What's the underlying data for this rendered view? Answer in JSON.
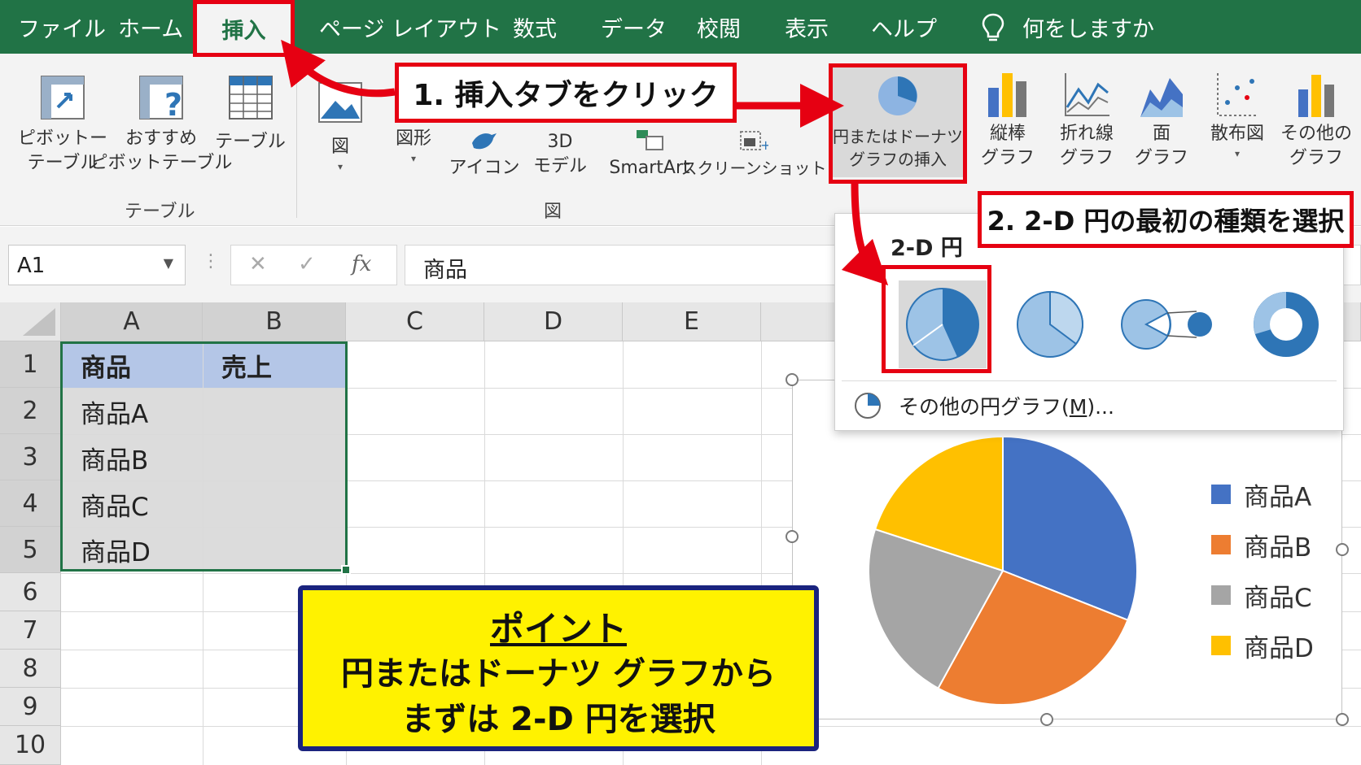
{
  "menu": {
    "tabs": [
      "ファイル",
      "ホーム",
      "挿入",
      "ページ レイアウト",
      "数式",
      "データ",
      "校閲",
      "表示",
      "ヘルプ"
    ],
    "active_tab": "挿入",
    "tell_me": "何をしますか"
  },
  "ribbon": {
    "pivot_table": [
      "ピボットー",
      "テーブル"
    ],
    "recommended_pivot": [
      "おすすめ",
      "ピボットテーブル"
    ],
    "table": "テーブル",
    "group_table": "テーブル",
    "figure": "図",
    "shapes": "図形",
    "icons": "アイコン",
    "model3d": [
      "3D",
      "モデル"
    ],
    "smartart": "SmartArt",
    "screenshot": "スクリーンショット",
    "group_figure": "図",
    "pie_donut": [
      "円またはドーナツ",
      "グラフの挿入"
    ],
    "column": [
      "縦棒",
      "グラフ"
    ],
    "line": [
      "折れ線",
      "グラフ"
    ],
    "area": [
      "面",
      "グラフ"
    ],
    "scatter": "散布図",
    "other": [
      "その他の",
      "グラフ"
    ]
  },
  "formula_bar": {
    "name_box": "A1",
    "cancel": "✕",
    "enter": "✓",
    "fx": "fx",
    "content": "商品"
  },
  "sheet": {
    "columns": [
      "A",
      "B",
      "C",
      "D",
      "E"
    ],
    "rows": [
      "1",
      "2",
      "3",
      "4",
      "5",
      "6",
      "7",
      "8",
      "9",
      "10"
    ],
    "cells": [
      [
        "商品",
        "売上"
      ],
      [
        "商品A",
        ""
      ],
      [
        "商品B",
        ""
      ],
      [
        "商品C",
        ""
      ],
      [
        "商品D",
        ""
      ]
    ]
  },
  "dropdown": {
    "heading": "2-D 円",
    "more_prefix": "その他の円グラフ(",
    "more_key": "M",
    "more_suffix": ")..."
  },
  "chart_data": {
    "type": "pie",
    "categories": [
      "商品A",
      "商品B",
      "商品C",
      "商品D"
    ],
    "values": [
      31,
      27,
      22,
      20
    ],
    "colors": [
      "#4472c4",
      "#ed7d31",
      "#a5a5a5",
      "#ffc000"
    ],
    "legend_position": "right"
  },
  "annotations": {
    "step1": "1. 挿入タブをクリック",
    "step2": "2. 2-D 円の最初の種類を選択",
    "point_title": "ポイント",
    "point_line1": "円またはドーナツ グラフから",
    "point_line2": "まずは 2-D 円を選択"
  },
  "colors": {
    "excel_green": "#217346",
    "highlight_red": "#e60012",
    "point_yellow": "#fff200",
    "point_border": "#1a237e",
    "header_blue": "#b4c6e7"
  }
}
